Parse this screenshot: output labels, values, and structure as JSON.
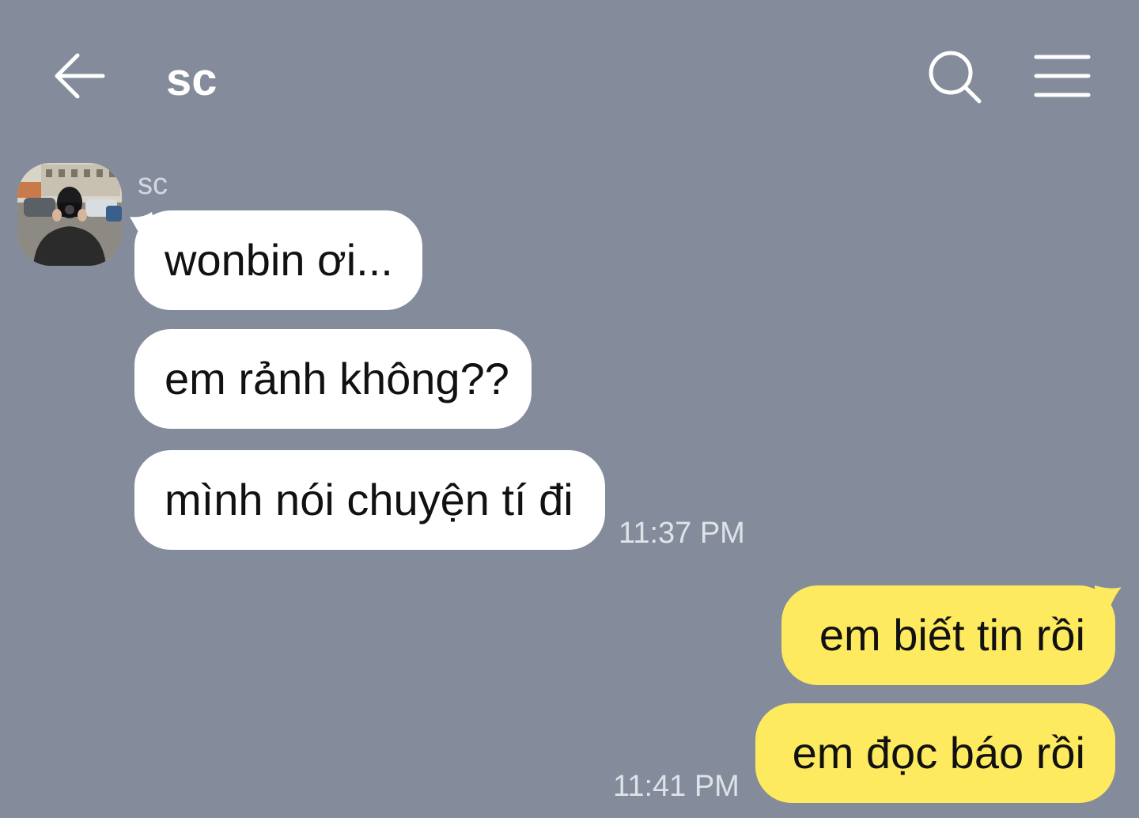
{
  "header": {
    "title": "sc",
    "back_icon": "arrow-left-icon",
    "search_icon": "search-icon",
    "menu_icon": "hamburger-menu-icon",
    "text_color": "#ffffff"
  },
  "theme": {
    "background": "#848b9b",
    "incoming_bubble": "#ffffff",
    "outgoing_bubble": "#fdea5e"
  },
  "conversation": {
    "sender_name": "sc",
    "incoming_messages": [
      {
        "text": "wonbin ơi..."
      },
      {
        "text": "em rảnh không??"
      },
      {
        "text": "mình nói chuyện tí đi"
      }
    ],
    "incoming_time": "11:37 PM",
    "outgoing_messages": [
      {
        "text": "em biết tin rồi"
      },
      {
        "text": "em đọc báo rồi"
      }
    ],
    "outgoing_time": "11:41 PM"
  }
}
